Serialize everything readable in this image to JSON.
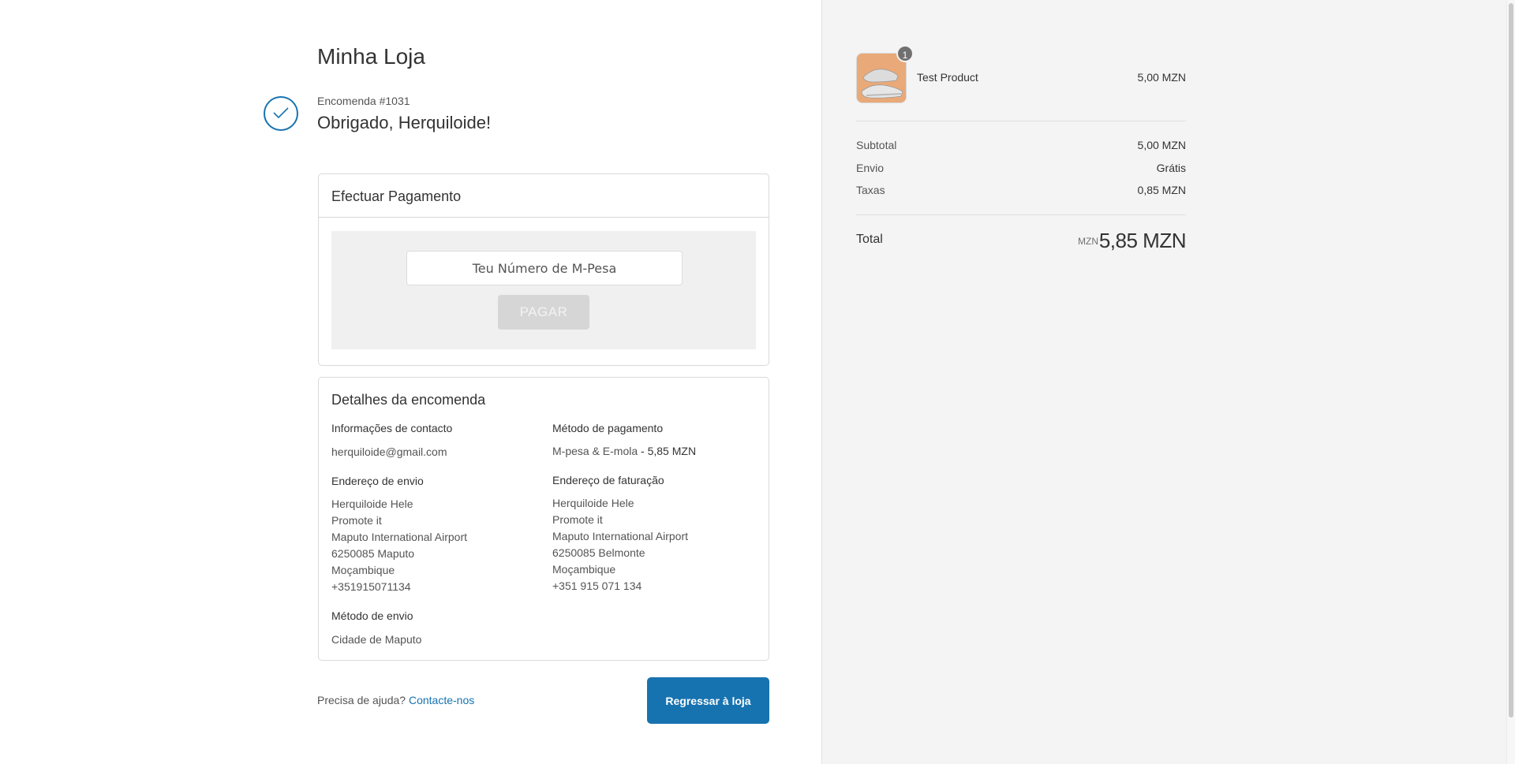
{
  "store": {
    "name": "Minha Loja"
  },
  "order": {
    "number": "Encomenda #1031",
    "thanks": "Obrigado, Herquiloide!"
  },
  "payment": {
    "title": "Efectuar Pagamento",
    "input_placeholder": "Teu Número de M-Pesa",
    "pay_label": "PAGAR"
  },
  "details": {
    "title": "Detalhes da encomenda",
    "contact": {
      "label": "Informações de contacto",
      "value": "herquiloide@gmail.com"
    },
    "shipping_address": {
      "label": "Endereço de envio",
      "lines": [
        "Herquiloide Hele",
        "Promote it",
        "Maputo International Airport",
        "6250085 Maputo",
        "Moçambique",
        "+351915071134"
      ]
    },
    "shipping_method": {
      "label": "Método de envio",
      "value": "Cidade de Maputo"
    },
    "payment_method": {
      "label": "Método de pagamento",
      "value": "M-pesa & E-mola",
      "amount": " - 5,85 MZN"
    },
    "billing_address": {
      "label": "Endereço de faturação",
      "lines": [
        "Herquiloide Hele",
        "Promote it",
        "Maputo International Airport",
        "6250085 Belmonte",
        "Moçambique",
        "+351 915 071 134"
      ]
    }
  },
  "footer": {
    "help_text": "Precisa de ajuda?",
    "contact_link": "Contacte-nos",
    "back_button": "Regressar à loja"
  },
  "summary": {
    "product": {
      "name": "Test Product",
      "price": "5,00 MZN",
      "quantity": "1",
      "image_icon": "sneaker-product-image"
    },
    "subtotal": {
      "label": "Subtotal",
      "value": "5,00 MZN"
    },
    "shipping": {
      "label": "Envio",
      "value": "Grátis"
    },
    "taxes": {
      "label": "Taxas",
      "value": "0,85 MZN"
    },
    "total": {
      "label": "Total",
      "currency": "MZN",
      "value": "5,85 MZN"
    }
  },
  "colors": {
    "accent": "#1773b0",
    "sidebar_bg": "#f4f4f4",
    "disabled_button": "#d6d6d6"
  }
}
